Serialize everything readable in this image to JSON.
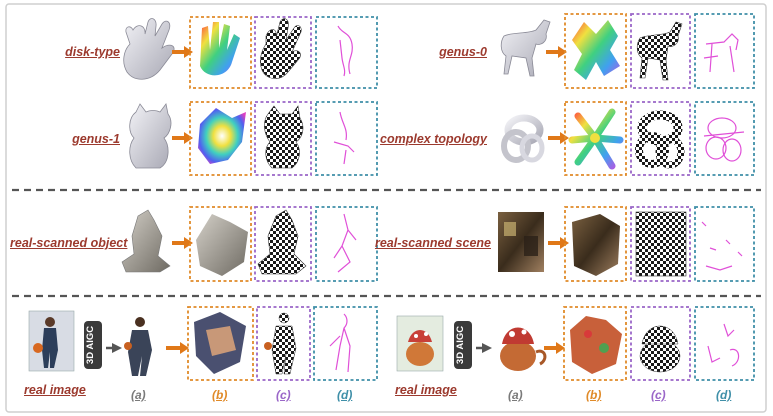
{
  "labels": {
    "disk_type": "disk-type",
    "genus_0": "genus-0",
    "genus_1": "genus-1",
    "complex_topology": "complex topology",
    "real_scanned_object": "real-scanned object",
    "real_scanned_scene": "real-scanned scene",
    "real_image_left": "real image",
    "real_image_right": "real image"
  },
  "aigc_label": "3D AIGC",
  "sub_labels": {
    "a": "(a)",
    "b": "(b)",
    "c": "(c)",
    "d": "(d)"
  },
  "colors": {
    "label_red": "#9c3a2e",
    "box_orange": "#e08a28",
    "box_purple": "#9a66c8",
    "box_teal": "#3f8fa8",
    "arrow_orange": "#e07818",
    "separator": "#555555",
    "curve_magenta": "#e050d8",
    "aigc_badge": "#3a3a3a"
  }
}
